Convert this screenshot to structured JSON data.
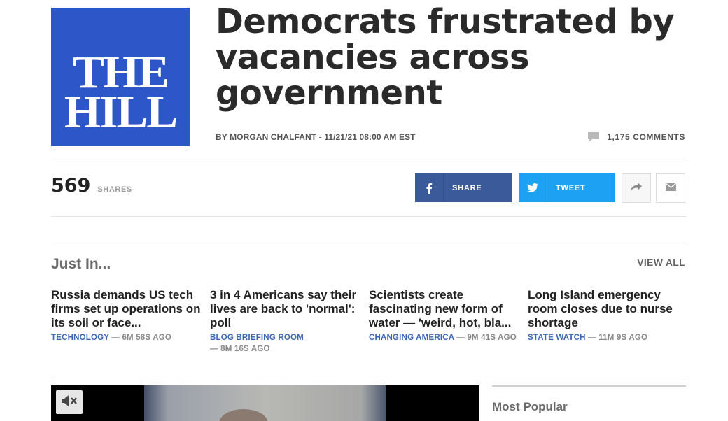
{
  "logo": {
    "line1": "THE",
    "line2": "HILL",
    "bg": "#2d56c8"
  },
  "article": {
    "headline": "Democrats frustrated by vacancies across government",
    "byline": "BY MORGAN CHALFANT - 11/21/21 08:00 AM EST",
    "comments": "1,175 COMMENTS"
  },
  "shares": {
    "count": "569",
    "label": "SHARES"
  },
  "share_buttons": {
    "facebook_label": "SHARE",
    "twitter_label": "TWEET",
    "facebook_color": "#3b5a9a",
    "twitter_color": "#1da1f2"
  },
  "just_in": {
    "title": "Just In...",
    "view_all": "VIEW ALL",
    "stories": [
      {
        "title": "Russia demands US tech firms set up operations on its soil or face...",
        "category": "TECHNOLOGY",
        "time": "— 6M 58S AGO"
      },
      {
        "title": "3 in 4 Americans say their lives are back to 'normal': poll",
        "category": "BLOG BRIEFING ROOM",
        "time": "— 8M 16S AGO"
      },
      {
        "title": "Scientists create fascinating new form of water — 'weird, hot, bla...",
        "category": "CHANGING AMERICA",
        "time": "— 9M 41S AGO"
      },
      {
        "title": "Long Island emergency room closes due to nurse shortage",
        "category": "STATE WATCH",
        "time": "— 11M 9S AGO"
      }
    ]
  },
  "sidebar": {
    "most_popular": "Most Popular"
  }
}
